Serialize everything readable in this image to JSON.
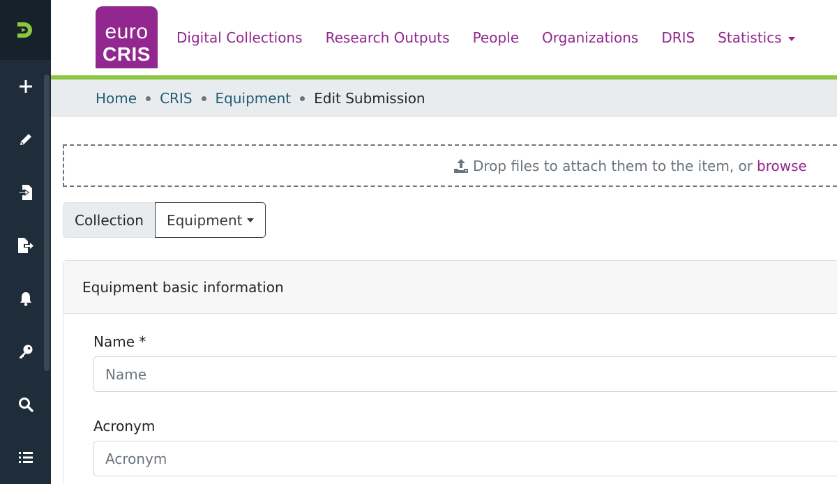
{
  "sidebar": {
    "items": [
      {
        "name": "add-icon"
      },
      {
        "name": "pencil-icon"
      },
      {
        "name": "import-icon"
      },
      {
        "name": "export-icon"
      },
      {
        "name": "bell-icon"
      },
      {
        "name": "key-icon"
      },
      {
        "name": "search-icon"
      },
      {
        "name": "list-icon"
      }
    ]
  },
  "logo": {
    "line1": "euro",
    "line2": "CRIS"
  },
  "nav": {
    "items": [
      "Digital Collections",
      "Research Outputs",
      "People",
      "Organizations",
      "DRIS"
    ],
    "statistics": "Statistics"
  },
  "breadcrumb": {
    "home": "Home",
    "cris": "CRIS",
    "equipment": "Equipment",
    "current": "Edit Submission"
  },
  "dropzone": {
    "text": "Drop files to attach them to the item, or",
    "browse": "browse"
  },
  "collection": {
    "label": "Collection",
    "selected": "Equipment"
  },
  "section": {
    "title": "Equipment basic information",
    "fields": [
      {
        "label": "Name *",
        "placeholder": "Name"
      },
      {
        "label": "Acronym",
        "placeholder": "Acronym"
      }
    ]
  },
  "colors": {
    "accent": "#92278f",
    "green_bar": "#8dc63f",
    "sidebar": "#1f2c3a"
  }
}
